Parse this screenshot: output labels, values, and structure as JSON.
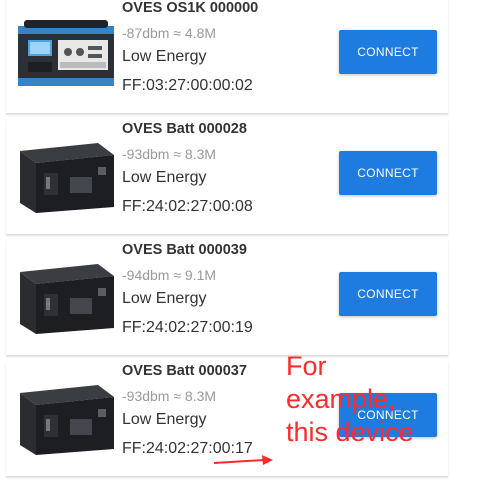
{
  "devices": [
    {
      "name": "OVES OS1K 000000",
      "signal": "-87dbm ≈ 4.8M",
      "type": "Low Energy",
      "mac": "FF:03:27:00:00:02",
      "button": "CONNECT",
      "icon": "portable-power-station-image"
    },
    {
      "name": "OVES Batt 000028",
      "signal": "-93dbm ≈ 8.3M",
      "type": "Low Energy",
      "mac": "FF:24:02:27:00:08",
      "button": "CONNECT",
      "icon": "battery-box-image"
    },
    {
      "name": "OVES Batt 000039",
      "signal": "-94dbm ≈ 9.1M",
      "type": "Low Energy",
      "mac": "FF:24:02:27:00:19",
      "button": "CONNECT",
      "icon": "battery-box-image"
    },
    {
      "name": "OVES Batt 000037",
      "signal": "-93dbm ≈ 8.3M",
      "type": "Low Energy",
      "mac": "FF:24:02:27:00:17",
      "button": "CONNECT",
      "icon": "battery-box-image"
    }
  ],
  "annotation": {
    "lines": [
      "For",
      "example,",
      "this device"
    ],
    "color": "#ff2a2a"
  },
  "colors": {
    "button": "#1e7ce0",
    "secondary_text": "#9a9a9a"
  }
}
